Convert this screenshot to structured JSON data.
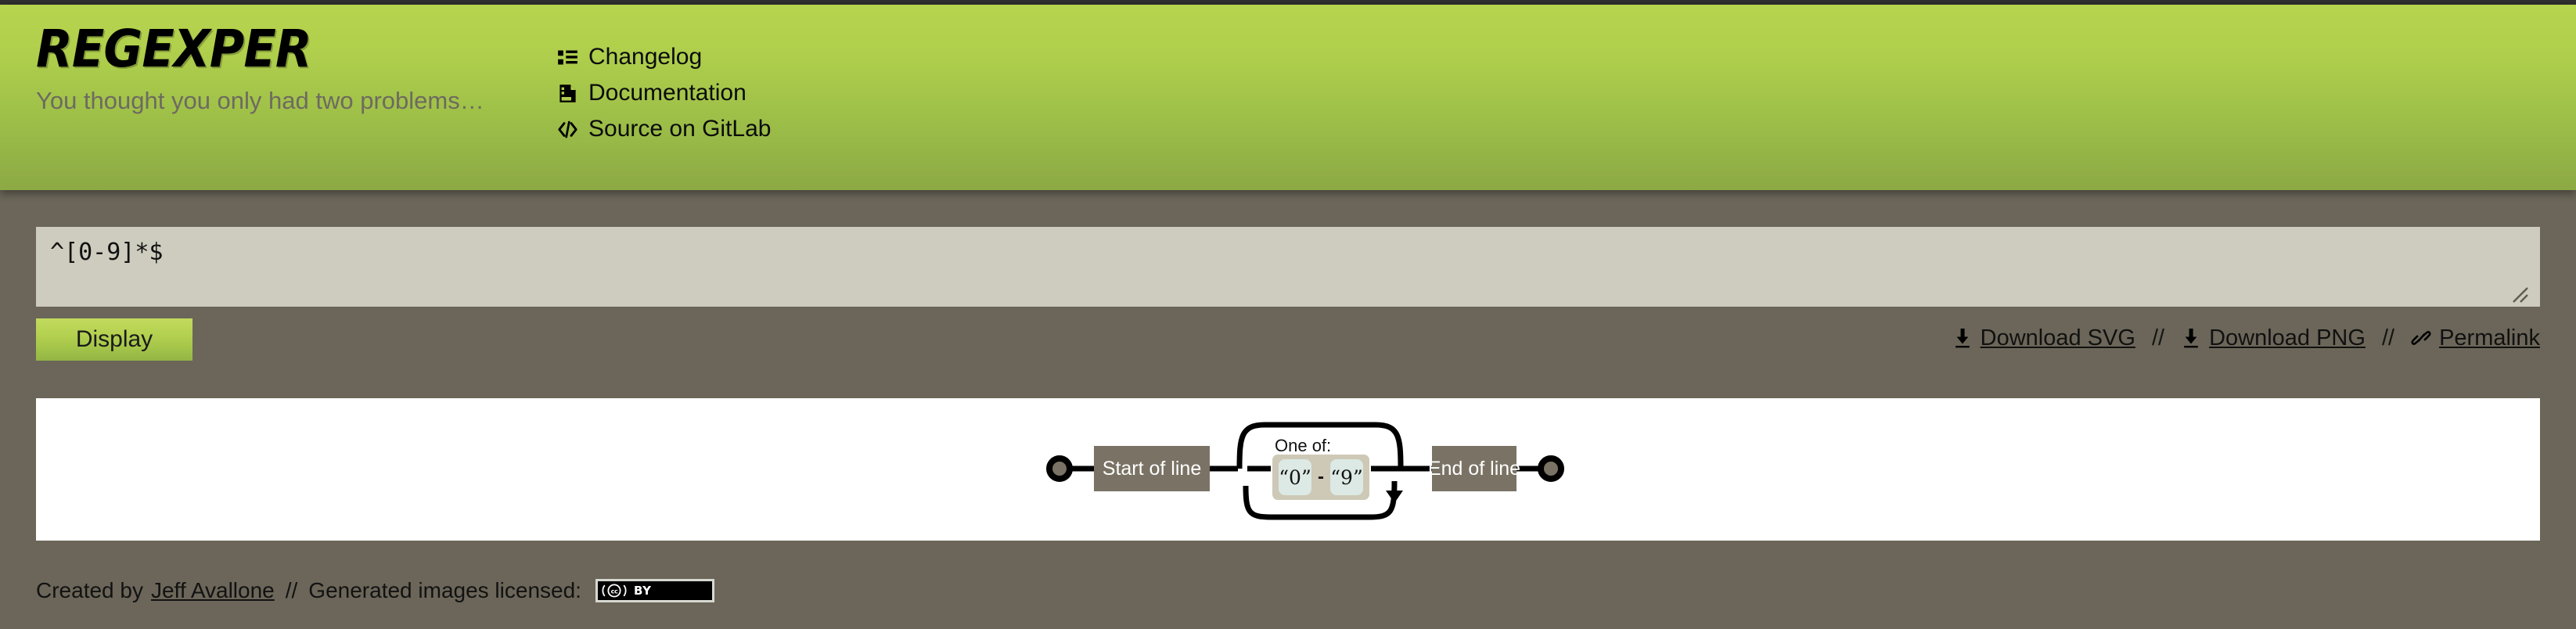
{
  "site": {
    "logo_text": "REGEXPER",
    "tagline": "You thought you only had two problems…"
  },
  "header": {
    "nav": [
      {
        "label": "Changelog",
        "icon": "list-icon"
      },
      {
        "label": "Documentation",
        "icon": "document-icon"
      },
      {
        "label": "Source on GitLab",
        "icon": "code-icon"
      }
    ]
  },
  "editor": {
    "regex_value": "^[0-9]*$",
    "regex_placeholder": "",
    "display_label": "Display"
  },
  "actions": {
    "download_svg_label": "Download SVG",
    "download_png_label": "Download PNG",
    "permalink_label": "Permalink",
    "separator": "//",
    "download_icon": "download-arrow-icon",
    "permalink_icon": "link-chain-icon"
  },
  "diagram": {
    "start_label": "Start of line",
    "end_label": "End of line",
    "group_label": "One of:",
    "range_from": "“0”",
    "range_dash": "-",
    "range_to": "“9”",
    "colors": {
      "node_fill": "#7a7365",
      "node_text": "#ffffff",
      "terminal_fill": "#7a7365",
      "terminal_stroke": "#000000",
      "path_stroke": "#000000",
      "group_fill": "#cdc9b6",
      "char_fill": "#dce9e4",
      "char_text": "#111111",
      "canvas_bg": "#ffffff"
    }
  },
  "footer": {
    "created_prefix": "Created by",
    "author": "Jeff Avallone",
    "separator": "//",
    "license_label": "Generated images licensed:",
    "license_badge_mark": "(cc)",
    "license_badge_by": "BY"
  },
  "theme": {
    "header_gradient_top": "#b7d44e",
    "header_gradient_bottom": "#8ca944",
    "body_bg": "#6b6659",
    "input_bg": "#cdccbe"
  }
}
